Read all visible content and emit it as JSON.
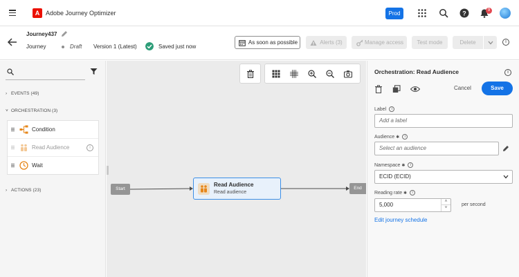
{
  "app": {
    "name": "Adobe Journey Optimizer",
    "logo_letter": "A",
    "env": "Prod",
    "notifications": "9"
  },
  "header": {
    "journey_name": "Journey437",
    "journey_label": "Journey",
    "status": "Draft",
    "version": "Version 1 (Latest)",
    "saved": "Saved just now",
    "schedule_button": "As soon as possible",
    "alerts_button": "Alerts (3)",
    "manage_access": "Manage access",
    "test_mode": "Test mode",
    "delete": "Delete"
  },
  "left": {
    "categories": [
      {
        "label": "EVENTS (49)"
      },
      {
        "label": "ORCHESTRATION (3)"
      },
      {
        "label": "ACTIONS (23)"
      }
    ],
    "orchestration_items": [
      {
        "label": "Condition"
      },
      {
        "label": "Read Audience"
      },
      {
        "label": "Wait"
      }
    ]
  },
  "canvas": {
    "start": "Start",
    "end": "End",
    "node_title": "Read Audience",
    "node_subtitle": "Read audience"
  },
  "right": {
    "title": "Orchestration: Read Audience",
    "cancel": "Cancel",
    "save": "Save",
    "label_field": {
      "label": "Label",
      "placeholder": "Add a label"
    },
    "audience_field": {
      "label": "Audience",
      "placeholder": "Select an audience"
    },
    "namespace_field": {
      "label": "Namespace",
      "value": "ECID (ECID)"
    },
    "reading_rate": {
      "label": "Reading rate",
      "value": "5,000",
      "unit": "per second"
    },
    "edit_schedule": "Edit journey schedule"
  },
  "colors": {
    "accent": "#1473e6",
    "brand": "#eb1000",
    "success": "#2d9d78",
    "badge": "#e34850"
  }
}
